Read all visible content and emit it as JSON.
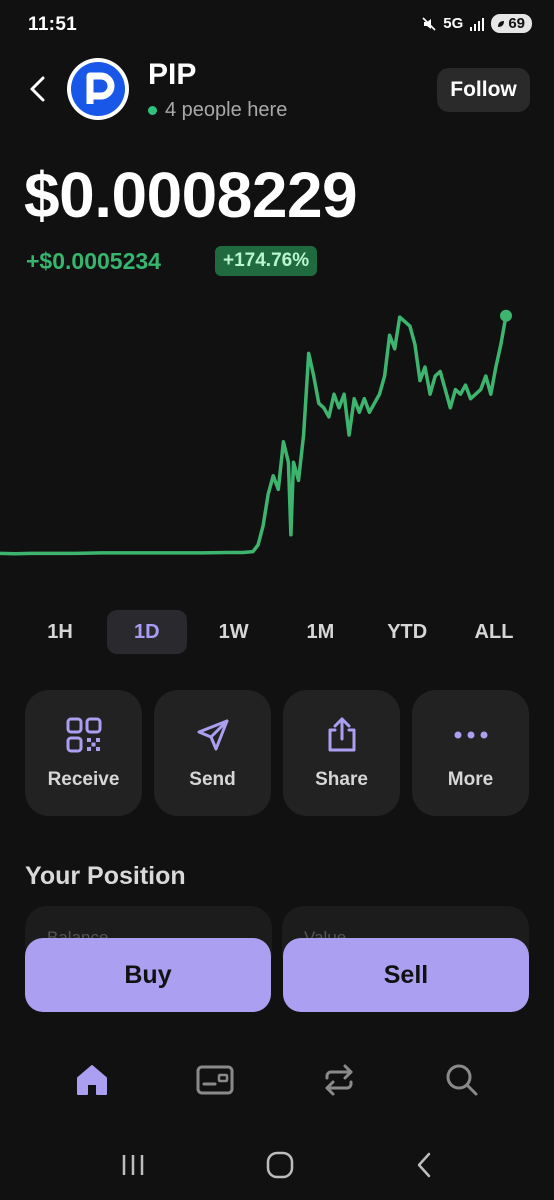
{
  "status_bar": {
    "time": "11:51",
    "network": "5G",
    "battery": "69"
  },
  "header": {
    "token_name": "PIP",
    "presence": "4 people here",
    "follow_label": "Follow"
  },
  "price": {
    "current": "$0.0008229",
    "change": "+$0.0005234",
    "change_pct": "+174.76%"
  },
  "chart_data": {
    "type": "line",
    "title": "",
    "series_color": "#3db56f",
    "x": [
      0,
      3,
      6,
      10,
      15,
      20,
      25,
      30,
      35,
      40,
      45,
      48,
      50,
      51,
      52,
      53,
      54,
      55,
      56,
      57,
      57.5,
      58,
      59,
      60,
      61,
      62,
      63,
      64,
      65,
      66,
      67,
      68,
      69,
      70,
      71,
      72,
      73,
      74,
      75,
      76,
      77,
      78,
      79,
      80,
      81,
      82,
      83,
      84,
      85,
      86,
      87,
      88,
      89,
      90,
      91,
      92,
      93,
      94,
      95,
      96,
      97,
      98,
      99,
      100
    ],
    "values": [
      0.000299,
      0.000298,
      0.000299,
      0.000299,
      0.000299,
      0.0003,
      0.0003,
      0.0003,
      0.0003,
      0.0003,
      0.000301,
      0.000301,
      0.000303,
      0.000318,
      0.00036,
      0.00043,
      0.00047,
      0.00044,
      0.000545,
      0.0005,
      0.00034,
      0.0005,
      0.00046,
      0.00056,
      0.00074,
      0.00069,
      0.00063,
      0.00062,
      0.0006,
      0.00065,
      0.00062,
      0.00065,
      0.00056,
      0.00064,
      0.00061,
      0.00064,
      0.00061,
      0.00063,
      0.00065,
      0.00069,
      0.00078,
      0.00075,
      0.00082,
      0.00081,
      0.0008,
      0.00076,
      0.00068,
      0.00071,
      0.00065,
      0.00069,
      0.0007,
      0.00066,
      0.00062,
      0.00066,
      0.00065,
      0.00067,
      0.00064,
      0.00065,
      0.00066,
      0.00069,
      0.00065,
      0.00071,
      0.00076,
      0.000823
    ],
    "ylim": [
      0.00028,
      0.00084
    ],
    "grid": false,
    "legend": "none"
  },
  "ranges": [
    "1H",
    "1D",
    "1W",
    "1M",
    "YTD",
    "ALL"
  ],
  "active_range": "1D",
  "actions": {
    "receive": "Receive",
    "send": "Send",
    "share": "Share",
    "more": "More"
  },
  "position": {
    "title": "Your Position",
    "balance_label": "Balance",
    "value_label": "Value"
  },
  "trade": {
    "buy": "Buy",
    "sell": "Sell"
  },
  "colors": {
    "accent": "#ab9ff2",
    "positive": "#36b56e",
    "background": "#111111",
    "card": "#222222"
  },
  "icons": {
    "nav": [
      "home-icon",
      "wallet-icon",
      "swap-icon",
      "search-icon"
    ]
  }
}
